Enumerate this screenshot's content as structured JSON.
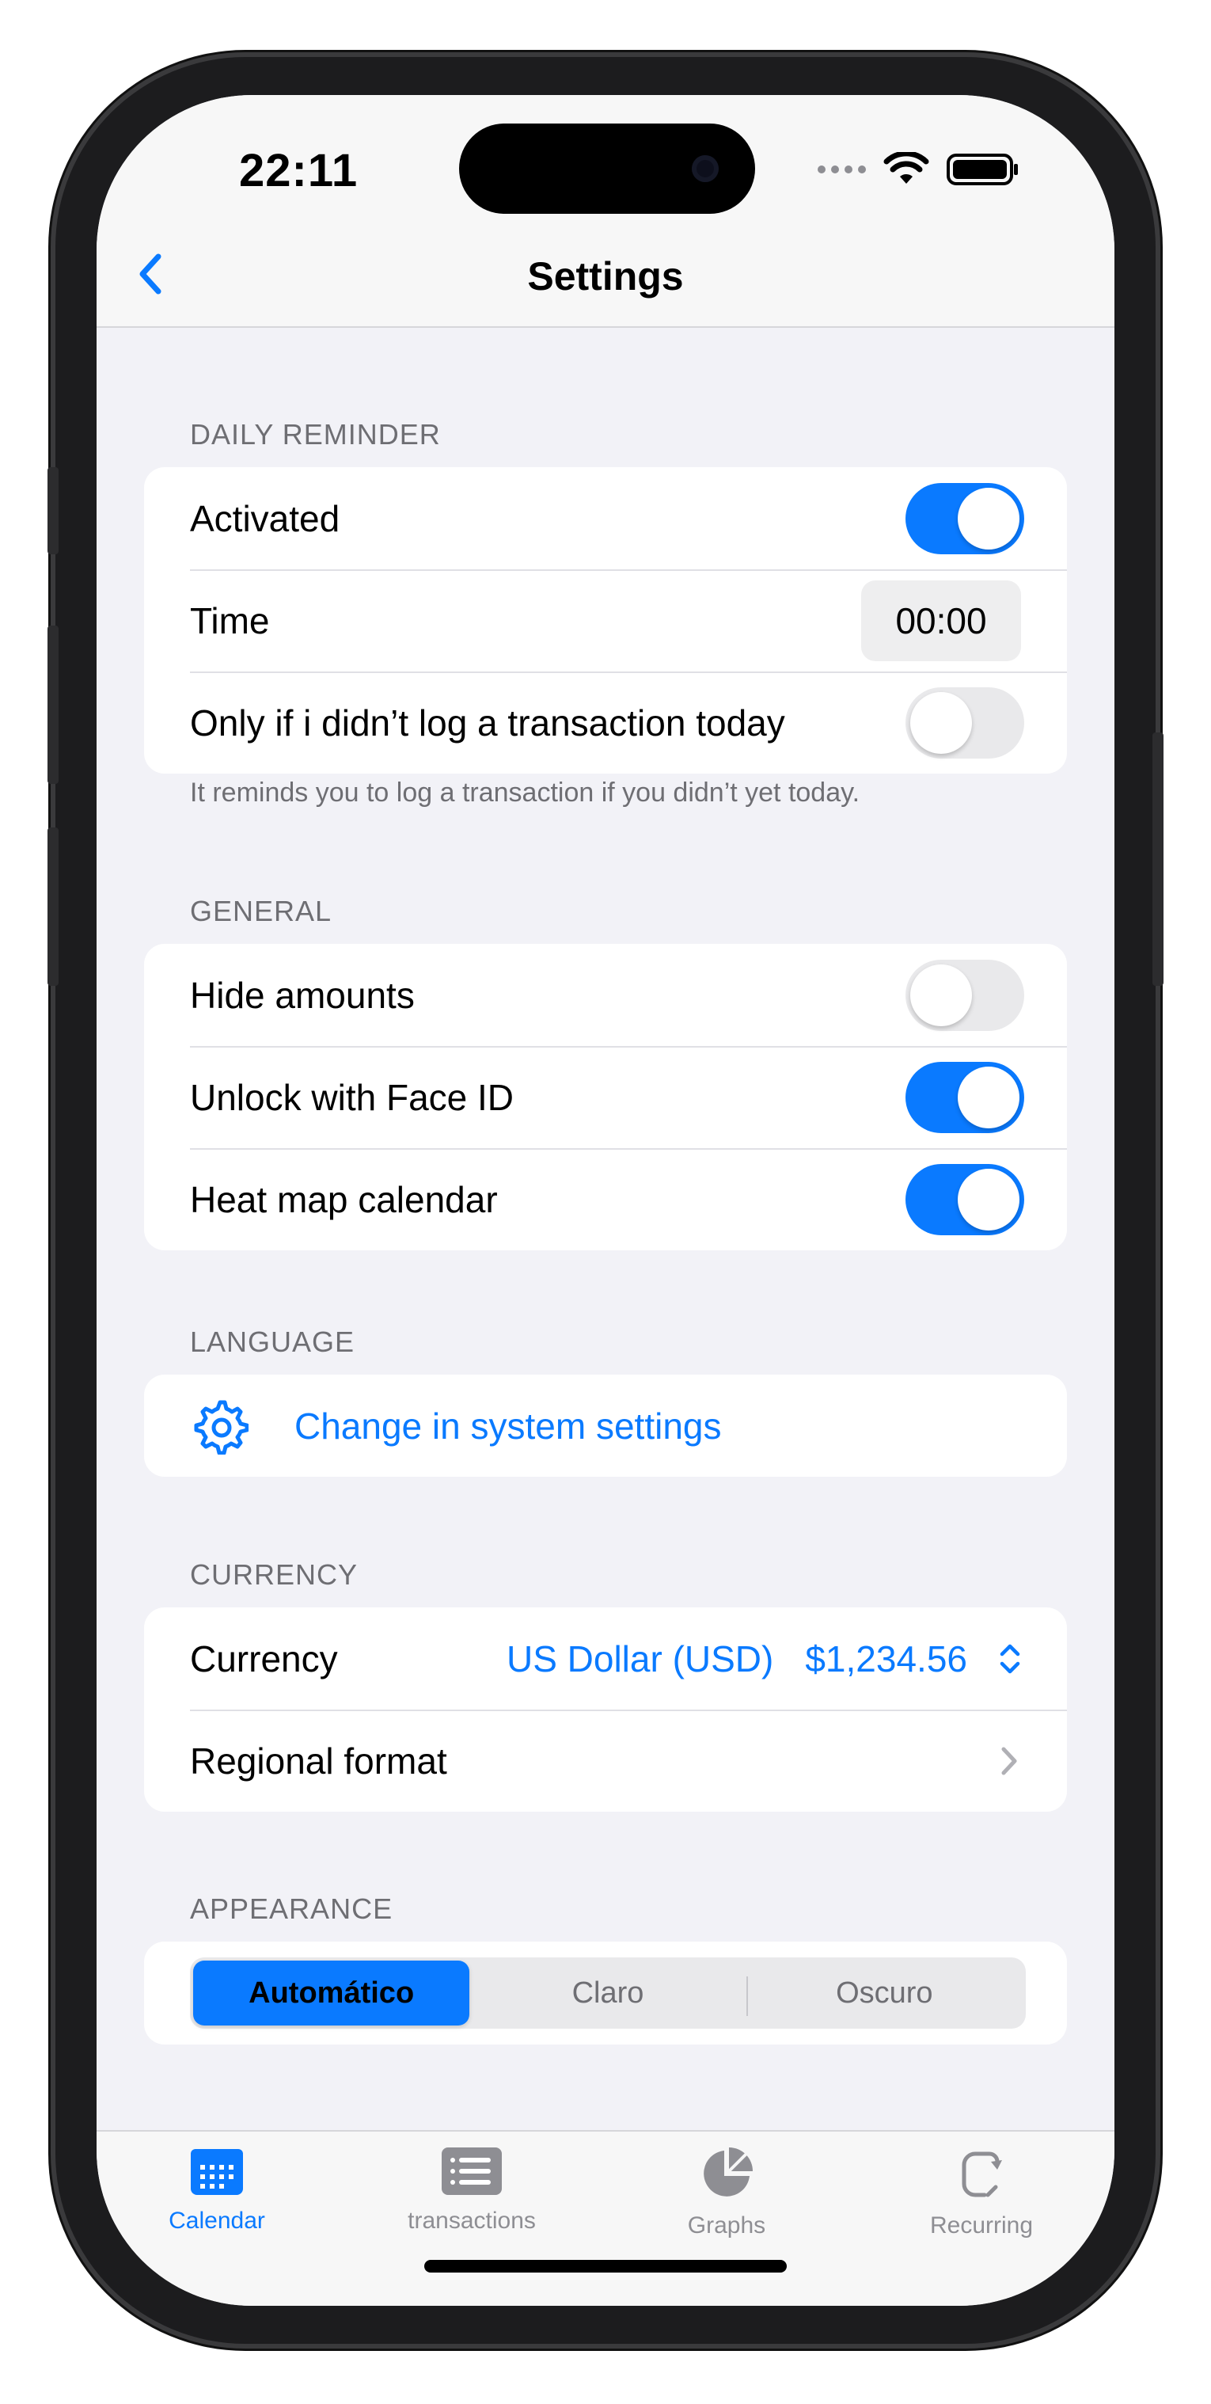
{
  "status": {
    "time": "22:11"
  },
  "nav": {
    "title": "Settings",
    "back_icon": "chevron-left-icon"
  },
  "daily_reminder": {
    "header": "DAILY REMINDER",
    "activated_label": "Activated",
    "activated_on": true,
    "time_label": "Time",
    "time_value": "00:00",
    "only_if_label": "Only if i didn’t log a transaction today",
    "only_if_on": false,
    "footer": "It reminds you to log a transaction if you didn’t yet today."
  },
  "general": {
    "header": "GENERAL",
    "hide_amounts_label": "Hide amounts",
    "hide_amounts_on": false,
    "face_id_label": "Unlock with Face ID",
    "face_id_on": true,
    "heat_map_label": "Heat map calendar",
    "heat_map_on": true
  },
  "language": {
    "header": "LANGUAGE",
    "change_label": "Change in system settings",
    "icon": "gear-icon"
  },
  "currency": {
    "header": "CURRENCY",
    "currency_label": "Currency",
    "currency_name": "US Dollar (USD)",
    "currency_example": "$1,234.56",
    "regional_label": "Regional format"
  },
  "appearance": {
    "header": "APPEARANCE",
    "options": [
      "Automático",
      "Claro",
      "Oscuro"
    ],
    "selected": "Automático"
  },
  "tabbar": {
    "tabs": [
      {
        "label": "Calendar",
        "icon": "calendar-icon",
        "active": true
      },
      {
        "label": "transactions",
        "icon": "list-icon",
        "active": false
      },
      {
        "label": "Graphs",
        "icon": "pie-chart-icon",
        "active": false
      },
      {
        "label": "Recurring",
        "icon": "recurring-icon",
        "active": false
      }
    ]
  },
  "colors": {
    "accent": "#0a7aff",
    "background": "#f2f2f7",
    "secondary_text": "#6e6e73"
  }
}
